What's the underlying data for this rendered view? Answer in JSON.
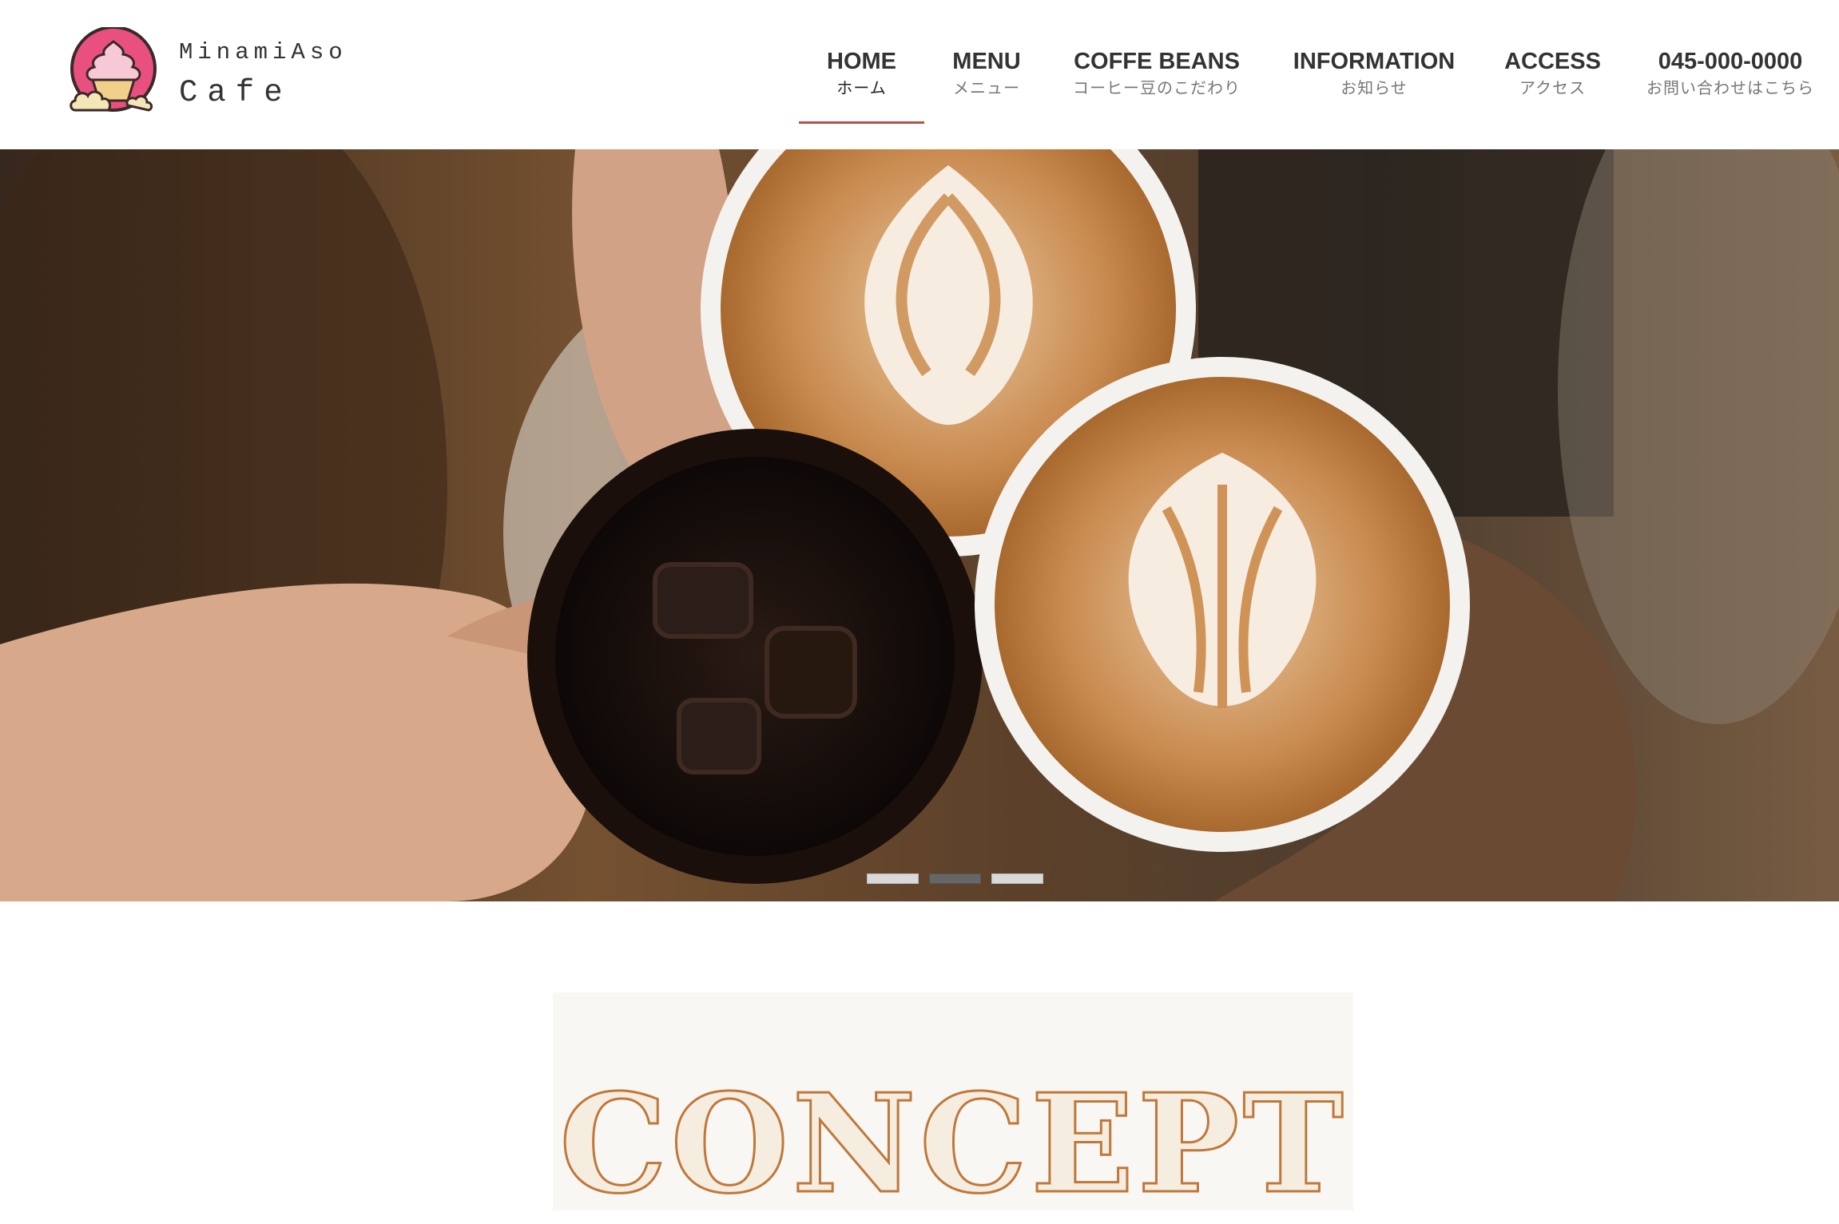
{
  "logo": {
    "line1": "MinamiAso",
    "line2": "Cafe",
    "icon": "soft-serve-icon"
  },
  "nav": {
    "items": [
      {
        "en": "HOME",
        "ja": "ホーム",
        "active": true
      },
      {
        "en": "MENU",
        "ja": "メニュー"
      },
      {
        "en": "COFFE BEANS",
        "ja": "コーヒー豆のこだわり"
      },
      {
        "en": "INFORMATION",
        "ja": "お知らせ"
      },
      {
        "en": "ACCESS",
        "ja": "アクセス"
      },
      {
        "en": "045-000-0000",
        "ja": "お問い合わせはこちら"
      }
    ]
  },
  "hero": {
    "slide_count": 3,
    "active_slide": 2
  },
  "concept": {
    "title": "CONCEPT"
  },
  "colors": {
    "accent_underline": "#b5524a",
    "logo_pink": "#e9507f",
    "concept_stroke": "#c0783a",
    "concept_fill": "#f4ede0"
  }
}
